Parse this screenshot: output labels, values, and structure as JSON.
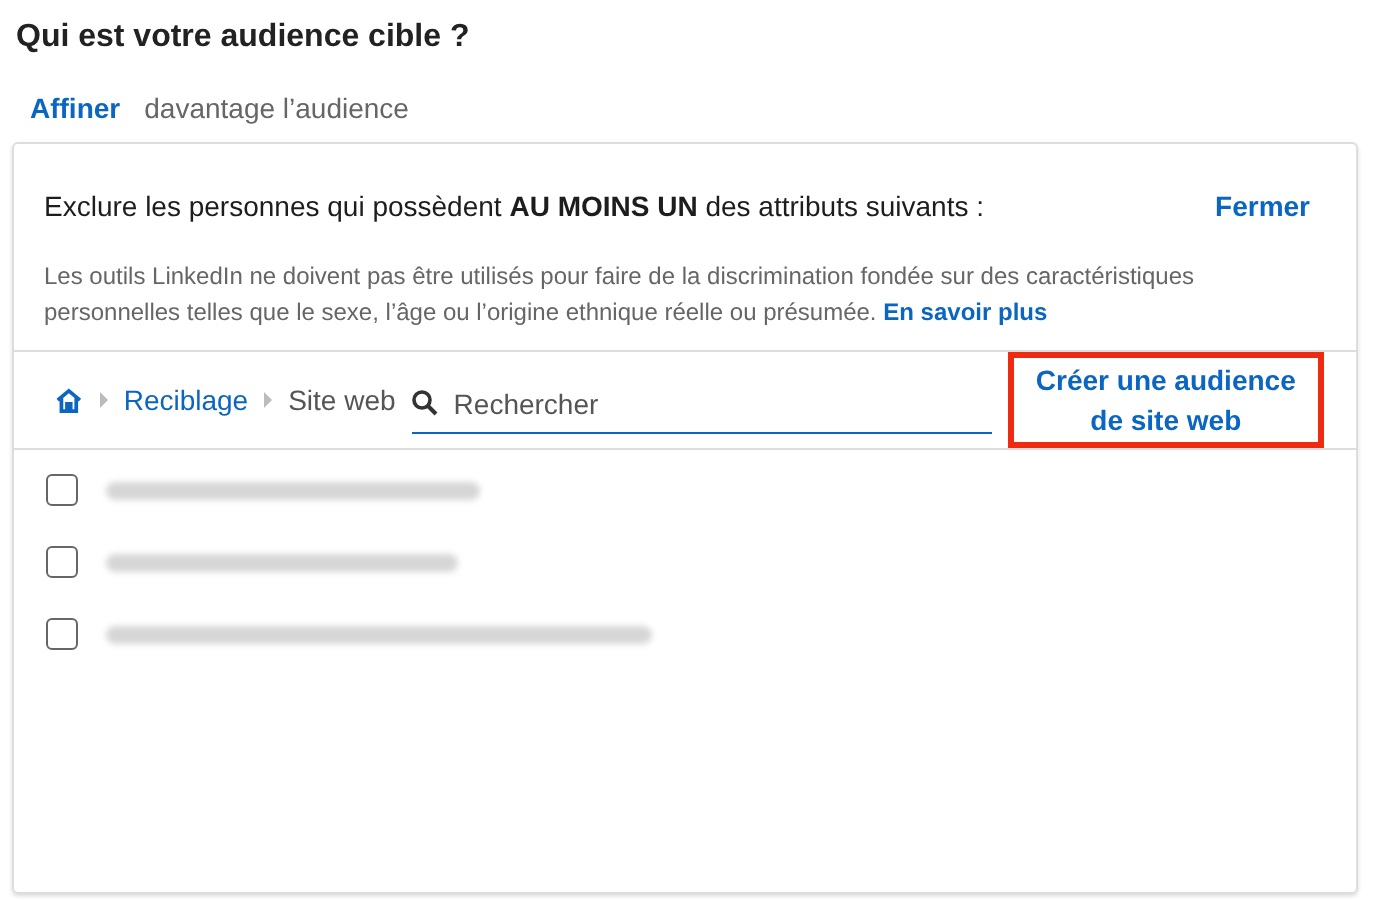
{
  "title": "Qui est votre audience cible ?",
  "refine": {
    "link": "Affiner",
    "text": "davantage l’audience"
  },
  "panel": {
    "heading": "Exclure les personnes qui possèdent **AU MOINS UN** des attributs suivants :",
    "close": "Fermer",
    "notice": "Les outils LinkedIn ne doivent pas être utilisés pour faire de la discrimination fondée sur des caractéristiques personnelles telles que le sexe, l’âge ou l’origine ethnique réelle ou présumée.",
    "learn_more": "En savoir plus",
    "breadcrumb": [
      {
        "label": "Reciblage",
        "kind": "link"
      },
      {
        "label": "Site web",
        "kind": "current"
      }
    ],
    "search": {
      "placeholder": "Rechercher"
    },
    "create": "Créer une audience de site web",
    "items": [
      {
        "checked": false
      },
      {
        "checked": false
      },
      {
        "checked": false
      }
    ]
  }
}
